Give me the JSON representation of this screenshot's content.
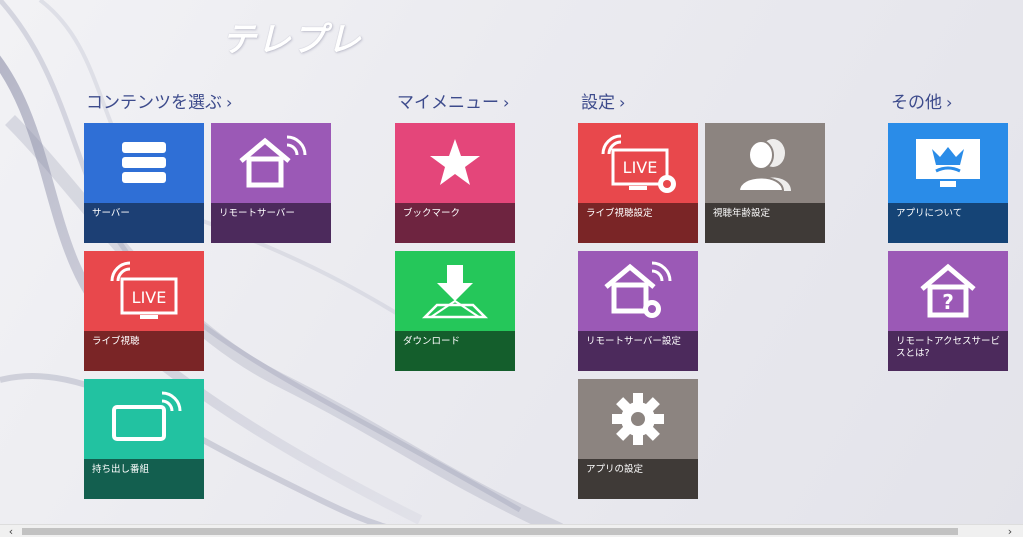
{
  "app": {
    "logo_text": "テレプレ"
  },
  "sections": {
    "content": {
      "title": "コンテンツを選ぶ",
      "chevron": "›"
    },
    "mymenu": {
      "title": "マイメニュー",
      "chevron": "›"
    },
    "settings": {
      "title": "設定",
      "chevron": "›"
    },
    "other": {
      "title": "その他",
      "chevron": "›"
    }
  },
  "tiles": {
    "server": {
      "label": "サーバー",
      "icon": "server-icon",
      "color": "#2f6fd6",
      "dark": "#1c3f74"
    },
    "remote_server": {
      "label": "リモートサーバー",
      "icon": "remote-home-icon",
      "color": "#9b59b6",
      "dark": "#4c2a5c"
    },
    "live": {
      "label": "ライブ視聴",
      "icon": "live-tv-icon",
      "icon_text": "LIVE",
      "color": "#e8484c",
      "dark": "#7a2526"
    },
    "takeout": {
      "label": "持ち出し番組",
      "icon": "tablet-wireless-icon",
      "color": "#22c2a1",
      "dark": "#135f4f"
    },
    "bookmark": {
      "label": "ブックマーク",
      "icon": "star-icon",
      "color": "#e4467a",
      "dark": "#6e2440"
    },
    "download": {
      "label": "ダウンロード",
      "icon": "download-icon",
      "color": "#25c75a",
      "dark": "#145e2c"
    },
    "live_settings": {
      "label": "ライブ視聴設定",
      "icon": "live-settings-icon",
      "icon_text": "LIVE",
      "color": "#e8484c",
      "dark": "#7a2526"
    },
    "age_settings": {
      "label": "視聴年齢設定",
      "icon": "users-icon",
      "color": "#8c8480",
      "dark": "#3f3a37"
    },
    "remote_settings": {
      "label": "リモートサーバー設定",
      "icon": "remote-settings-icon",
      "color": "#9b59b6",
      "dark": "#4c2a5c"
    },
    "app_settings": {
      "label": "アプリの設定",
      "icon": "gear-icon",
      "color": "#8c8480",
      "dark": "#3f3a37"
    },
    "about": {
      "label": "アプリについて",
      "icon": "app-info-icon",
      "color": "#2a8ce8",
      "dark": "#154476"
    },
    "remote_access": {
      "label": "リモートアクセスサービスとは?",
      "icon": "home-question-icon",
      "color": "#9b59b6",
      "dark": "#4c2a5c"
    }
  },
  "scrollbar": {
    "left_arrow": "‹",
    "right_arrow": "›"
  }
}
